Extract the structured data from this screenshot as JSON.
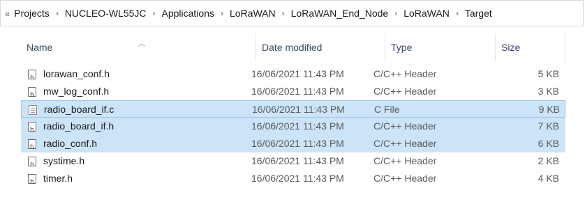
{
  "address_bar": {
    "overflow_icon": "double-chevron-left-icon",
    "crumbs": [
      "Projects",
      "NUCLEO-WL55JC",
      "Applications",
      "LoRaWAN",
      "LoRaWAN_End_Node",
      "LoRaWAN",
      "Target"
    ]
  },
  "columns": {
    "name": "Name",
    "date": "Date modified",
    "type": "Type",
    "size": "Size"
  },
  "files": [
    {
      "name": "lorawan_conf.h",
      "date": "16/06/2021 11:43 PM",
      "type": "C/C++ Header",
      "size": "5 KB",
      "icon": "header-file-icon",
      "selected": false
    },
    {
      "name": "mw_log_conf.h",
      "date": "16/06/2021 11:43 PM",
      "type": "C/C++ Header",
      "size": "3 KB",
      "icon": "header-file-icon",
      "selected": false
    },
    {
      "name": "radio_board_if.c",
      "date": "16/06/2021 11:43 PM",
      "type": "C File",
      "size": "9 KB",
      "icon": "c-file-icon",
      "selected": true
    },
    {
      "name": "radio_board_if.h",
      "date": "16/06/2021 11:43 PM",
      "type": "C/C++ Header",
      "size": "7 KB",
      "icon": "header-file-icon",
      "selected": true
    },
    {
      "name": "radio_conf.h",
      "date": "16/06/2021 11:43 PM",
      "type": "C/C++ Header",
      "size": "6 KB",
      "icon": "header-file-icon",
      "selected": true
    },
    {
      "name": "systime.h",
      "date": "16/06/2021 11:43 PM",
      "type": "C/C++ Header",
      "size": "2 KB",
      "icon": "header-file-icon",
      "selected": false
    },
    {
      "name": "timer.h",
      "date": "16/06/2021 11:43 PM",
      "type": "C/C++ Header",
      "size": "4 KB",
      "icon": "header-file-icon",
      "selected": false
    }
  ],
  "colors": {
    "selection": "#cce4f7",
    "selection_border": "#9ac7ee",
    "header_text": "#3a4a6b"
  }
}
